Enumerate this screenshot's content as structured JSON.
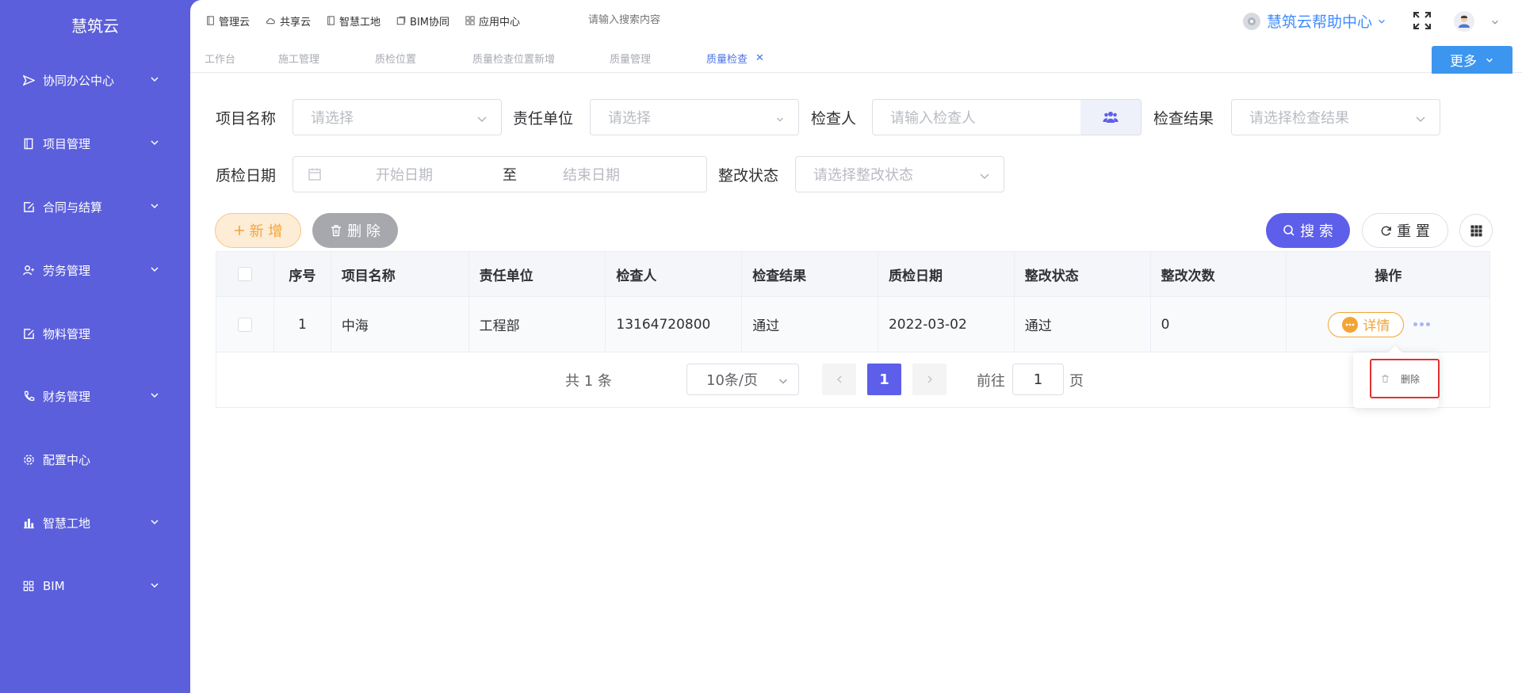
{
  "sidebar": {
    "brand": "慧筑云",
    "items": [
      {
        "label": "协同办公中心",
        "icon": "send-icon",
        "has_children": true
      },
      {
        "label": "项目管理",
        "icon": "book-icon",
        "has_children": true
      },
      {
        "label": "合同与结算",
        "icon": "edit-doc-icon",
        "has_children": true
      },
      {
        "label": "劳务管理",
        "icon": "users-icon",
        "has_children": true
      },
      {
        "label": "物料管理",
        "icon": "edit-doc-icon",
        "has_children": false
      },
      {
        "label": "财务管理",
        "icon": "phone-icon",
        "has_children": true
      },
      {
        "label": "配置中心",
        "icon": "gear-icon",
        "has_children": false
      },
      {
        "label": "智慧工地",
        "icon": "building-icon",
        "has_children": true
      },
      {
        "label": "BIM",
        "icon": "grid-icon",
        "has_children": true
      }
    ]
  },
  "topbar": {
    "nav": [
      {
        "label": "管理云",
        "icon": "book-icon"
      },
      {
        "label": "共享云",
        "icon": "cloud-icon"
      },
      {
        "label": "智慧工地",
        "icon": "book-icon"
      },
      {
        "label": "BIM协同",
        "icon": "doc-icon"
      },
      {
        "label": "应用中心",
        "icon": "apps-icon"
      }
    ],
    "search_placeholder": "请输入搜索内容",
    "help_label": "慧筑云帮助中心"
  },
  "tabs": {
    "items": [
      "工作台",
      "施工管理",
      "质检位置",
      "质量检查位置新增",
      "质量管理",
      "质量检查"
    ],
    "active": "质量检查",
    "more_label": "更多"
  },
  "filters": {
    "project_label": "项目名称",
    "project_placeholder": "请选择",
    "unit_label": "责任单位",
    "unit_placeholder": "请选择",
    "inspector_label": "检查人",
    "inspector_placeholder": "请输入检查人",
    "result_label": "检查结果",
    "result_placeholder": "请选择检查结果",
    "date_label": "质检日期",
    "start_placeholder": "开始日期",
    "date_sep": "至",
    "end_placeholder": "结束日期",
    "rectify_label": "整改状态",
    "rectify_placeholder": "请选择整改状态"
  },
  "actions": {
    "add": "新 增",
    "delete": "删 除",
    "search": "搜 索",
    "reset": "重 置"
  },
  "table": {
    "columns": [
      "序号",
      "项目名称",
      "责任单位",
      "检查人",
      "检查结果",
      "质检日期",
      "整改状态",
      "整改次数",
      "操作"
    ],
    "rows": [
      {
        "index": "1",
        "project": "中海",
        "unit": "工程部",
        "inspector": "13164720800",
        "result": "通过",
        "date": "2022-03-02",
        "rectify_status": "通过",
        "rectify_count": "0"
      }
    ],
    "detail_label": "详情"
  },
  "pagination": {
    "total": "共 1 条",
    "page_size": "10条/页",
    "current_page": "1",
    "goto_label": "前往",
    "goto_value": "1",
    "page_suffix": "页"
  },
  "dropdown": {
    "delete_label": "删除"
  }
}
